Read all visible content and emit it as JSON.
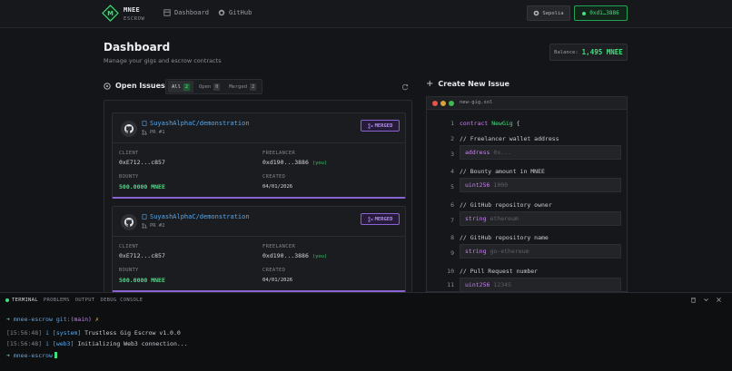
{
  "header": {
    "brand_name": "MNEE",
    "brand_sub": "ESCROW",
    "nav": [
      {
        "label": "Dashboard",
        "icon": "dashboard-icon"
      },
      {
        "label": "GitHub",
        "icon": "github-icon"
      }
    ],
    "network": "Sepolia",
    "wallet": "0xd1…3886"
  },
  "page": {
    "title": "Dashboard",
    "subtitle": "Manage your gigs and escrow contracts",
    "balance_label": "Balance:",
    "balance_value": "1,495 MNEE"
  },
  "issues": {
    "heading": "Open Issues",
    "filters": [
      {
        "label": "All",
        "count": "2",
        "active": true
      },
      {
        "label": "Open",
        "count": "0",
        "active": false
      },
      {
        "label": "Merged",
        "count": "2",
        "active": false
      }
    ],
    "cards": [
      {
        "repo": "SuyashAlphaC/demonstration",
        "pr": "PR #1",
        "status": "MERGED",
        "client_label": "CLIENT",
        "client": "0xE712...c857",
        "freelancer_label": "FREELANCER",
        "freelancer": "0xd190...3886",
        "you": "(you)",
        "bounty_label": "BOUNTY",
        "bounty": "500.0000 MNEE",
        "created_label": "CREATED",
        "created": "04/01/2026"
      },
      {
        "repo": "SuyashAlphaC/demonstration",
        "pr": "PR #2",
        "status": "MERGED",
        "client_label": "CLIENT",
        "client": "0xE712...c857",
        "freelancer_label": "FREELANCER",
        "freelancer": "0xd190...3886",
        "you": "(you)",
        "bounty_label": "BOUNTY",
        "bounty": "500.0000 MNEE",
        "created_label": "CREATED",
        "created": "04/01/2026"
      }
    ]
  },
  "create": {
    "heading": "Create New Issue",
    "filename": "new-gig.sol",
    "lines": [
      {
        "n": "1",
        "kw": "contract",
        "name": "NewGig",
        "rest": " {"
      },
      {
        "n": "2",
        "comment": "// Freelancer wallet address"
      },
      {
        "n": "3",
        "type": "address",
        "placeholder": "0x..."
      },
      {
        "n": "4",
        "comment": "// Bounty amount in MNEE"
      },
      {
        "n": "5",
        "type": "uint256",
        "placeholder": "1000"
      },
      {
        "n": "6",
        "comment": "// GitHub repository owner"
      },
      {
        "n": "7",
        "type": "string",
        "placeholder": "ethereum"
      },
      {
        "n": "8",
        "comment": "// GitHub repository name"
      },
      {
        "n": "9",
        "type": "string",
        "placeholder": "go-ethereum"
      },
      {
        "n": "10",
        "comment": "// Pull Request number"
      },
      {
        "n": "11",
        "type": "uint256",
        "placeholder": "12345"
      }
    ]
  },
  "terminal": {
    "tabs": [
      "TERMINAL",
      "PROBLEMS",
      "OUTPUT",
      "DEBUG CONSOLE"
    ],
    "prompt_path": "mnee-escrow",
    "prompt_git": "git:",
    "prompt_branch": "(main)",
    "prompt_mark": "✗",
    "logs": [
      {
        "ts": "[15:56:48]",
        "icon": "i",
        "tag": "[system]",
        "msg": "Trustless Gig Escrow v1.0.0"
      },
      {
        "ts": "[15:56:48]",
        "icon": "i",
        "tag": "[web3]",
        "msg": "Initializing Web3 connection..."
      }
    ],
    "prompt2": "mnee-escrow"
  }
}
